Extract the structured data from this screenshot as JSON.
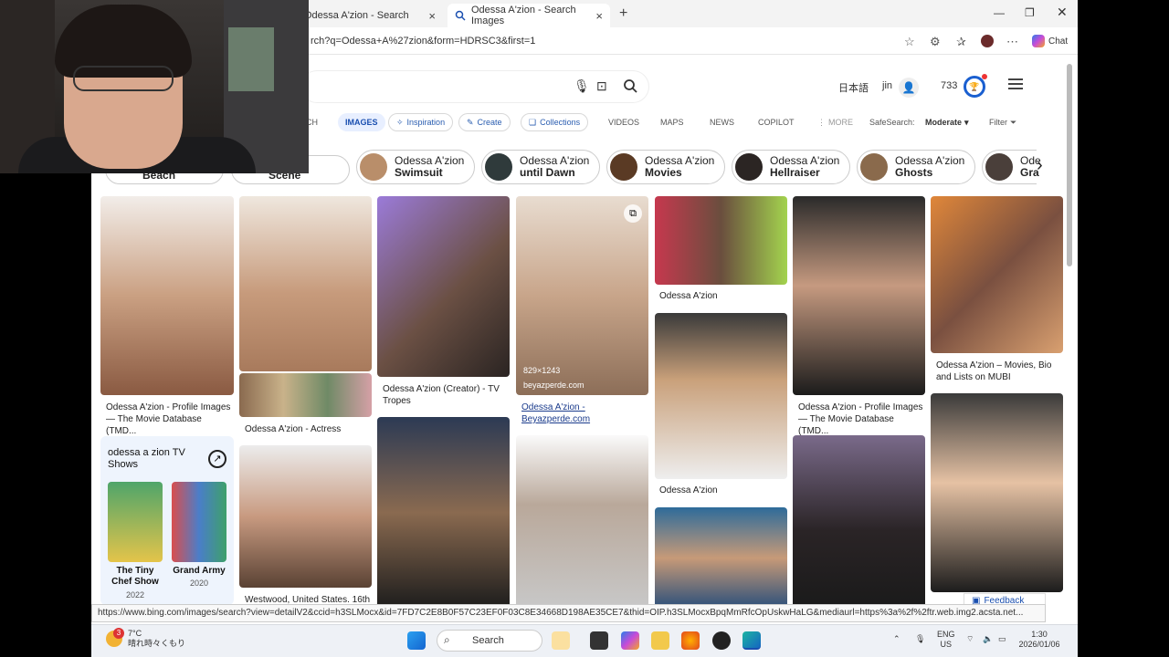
{
  "browser": {
    "tabs": [
      {
        "title": "Odessa A'zion - Search"
      },
      {
        "title": "Odessa A'zion - Search Images"
      }
    ],
    "new_tab": "+",
    "url": "rch?q=Odessa+A%27zion&form=HDRSC3&first=1",
    "copilot_label": "Chat"
  },
  "header": {
    "language": "日本語",
    "user": "jin",
    "points": "733"
  },
  "nav": {
    "all_partial": "CH",
    "images": "IMAGES",
    "inspiration": "Inspiration",
    "create": "Create",
    "collections": "Collections",
    "videos": "VIDEOS",
    "maps": "MAPS",
    "news": "NEWS",
    "copilot": "COPILOT",
    "more": "MORE",
    "safesearch_label": "SafeSearch:",
    "safesearch_value": "Moderate",
    "filter": "Filter"
  },
  "related_chips": [
    {
      "line1": "",
      "line2": "Beach"
    },
    {
      "line1": "",
      "line2": "Scene"
    },
    {
      "line1": "Odessa A'zion",
      "line2": "Swimsuit"
    },
    {
      "line1": "Odessa A'zion",
      "line2": "until Dawn"
    },
    {
      "line1": "Odessa A'zion",
      "line2": "Movies"
    },
    {
      "line1": "Odessa A'zion",
      "line2": "Hellraiser"
    },
    {
      "line1": "Odessa A'zion",
      "line2": "Ghosts"
    },
    {
      "line1": "Ode",
      "line2": "Gra"
    }
  ],
  "results": {
    "captions": [
      "Odessa A'zion - Profile Images — The Movie Database (TMD...",
      "Odessa A'zion - Actress",
      "Odessa A'zion (Creator) - TV Tropes",
      "Odessa A'zion - Beyazperde.com",
      "Odessa A'zion",
      "Odessa A'zion",
      "Odessa A'zion - Profile Images — The Movie Database (TMD...",
      "Odessa A'zion – Movies, Bio and Lists on MUBI",
      "Westwood, United States. 16th"
    ],
    "hover_dimensions": "829×1243",
    "hover_source": "beyazperde.com",
    "tv_card": {
      "title": "odessa a zion TV Shows",
      "shows": [
        {
          "name": "The Tiny Chef Show",
          "year": "2022"
        },
        {
          "name": "Grand Army",
          "year": "2020"
        }
      ]
    }
  },
  "status_url": "https://www.bing.com/images/search?view=detailV2&ccid=h3SLMocx&id=7FD7C2E8B0F57C23EF0F03C8E34668D198AE35CE7&thid=OIP.h3SLMocxBpqMmRfcOpUskwHaLG&mediaurl=https%3a%2f%2ftr.web.img2.acsta.net...",
  "feedback": "Feedback",
  "taskbar": {
    "temp": "7°C",
    "weather": "晴れ時々くもり",
    "search": "Search",
    "lang1": "ENG",
    "lang2": "US",
    "time": "1:30",
    "date": "2026/01/06",
    "notify_count": "3"
  },
  "colors": {
    "accent": "#1a4fb0",
    "reward": "#1a5fd0"
  }
}
